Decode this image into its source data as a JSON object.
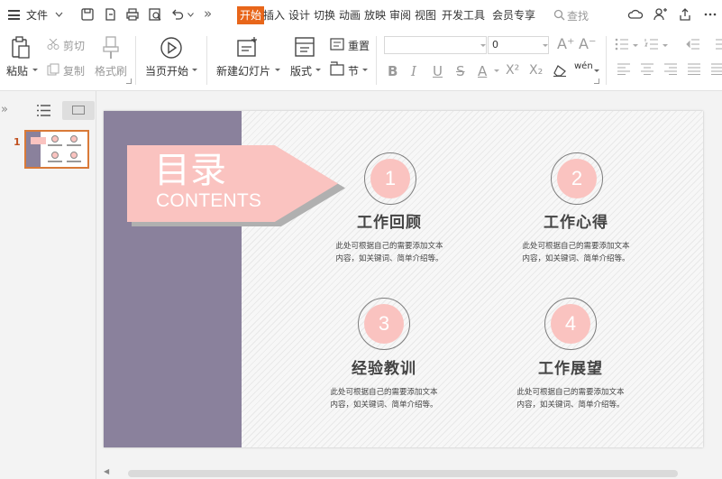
{
  "menubar": {
    "file_label": "文件",
    "tabs": [
      "开始",
      "插入",
      "设计",
      "切换",
      "动画",
      "放映",
      "审阅",
      "视图",
      "开发工具",
      "会员专享"
    ],
    "search_label": "查找",
    "more_label": "»"
  },
  "ribbon": {
    "paste": "粘贴",
    "cut": "剪切",
    "copy": "复制",
    "format_painter": "格式刷",
    "start_from_current": "当页开始",
    "new_slide": "新建幻灯片",
    "layout": "版式",
    "reset": "重置",
    "section": "节",
    "font_name_value": "",
    "font_size_value": "0",
    "bold": "B",
    "italic": "I",
    "underline": "U",
    "strikethrough": "S",
    "font_color": "A",
    "superscript": "X²",
    "subscript": "X₂",
    "pinyin": "wén"
  },
  "left_pane": {
    "slide_number": "1"
  },
  "slide": {
    "title": "目录",
    "subtitle": "CONTENTS",
    "items": [
      {
        "number": "1",
        "title": "工作回顾",
        "desc_line1": "此处可根据自己的需要添加文本",
        "desc_line2": "内容，如关键词、简单介绍等。"
      },
      {
        "number": "2",
        "title": "工作心得",
        "desc_line1": "此处可根据自己的需要添加文本",
        "desc_line2": "内容，如关键词、简单介绍等。"
      },
      {
        "number": "3",
        "title": "经验教训",
        "desc_line1": "此处可根据自己的需要添加文本",
        "desc_line2": "内容，如关键词、简单介绍等。"
      },
      {
        "number": "4",
        "title": "工作展望",
        "desc_line1": "此处可根据自己的需要添加文本",
        "desc_line2": "内容，如关键词、简单介绍等。"
      }
    ]
  },
  "colors": {
    "accent": "#e8661a",
    "slide_band": "#8a819c",
    "slide_pink": "#fac3c0"
  }
}
